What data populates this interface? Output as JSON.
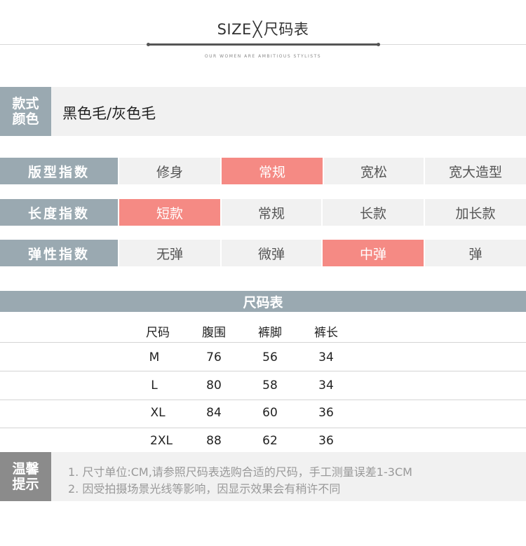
{
  "header": {
    "title_prefix": "SIZE",
    "title_cross": "╳",
    "title_suffix": "尺码表",
    "subtitle": "OUR WOMEN ARE AMBITIOUS STYLISTS"
  },
  "style_row": {
    "label_line1": "款式",
    "label_line2": "颜色",
    "value": "黑色毛/灰色毛"
  },
  "indexes": [
    {
      "label": "版型指数",
      "options": [
        "修身",
        "常规",
        "宽松",
        "宽大造型"
      ],
      "selected": 1
    },
    {
      "label": "长度指数",
      "options": [
        "短款",
        "常规",
        "长款",
        "加长款"
      ],
      "selected": 0
    },
    {
      "label": "弹性指数",
      "options": [
        "无弹",
        "微弹",
        "中弹",
        "弹"
      ],
      "selected": 2
    }
  ],
  "size_table": {
    "title": "尺码表",
    "headers": [
      "尺码",
      "腹围",
      "裤脚",
      "裤长"
    ],
    "rows": [
      [
        "M",
        "76",
        "56",
        "34"
      ],
      [
        "L",
        "80",
        "58",
        "34"
      ],
      [
        "XL",
        "84",
        "60",
        "36"
      ],
      [
        "2XL",
        "88",
        "62",
        "36"
      ]
    ]
  },
  "tips": {
    "label_line1": "温馨",
    "label_line2": "提示",
    "lines": [
      "1. 尺寸单位:CM,请参照尺码表选购合适的尺码，手工测量误差1-3CM",
      "2. 因受拍摄场景光线等影响，因显示效果会有稍许不同"
    ]
  },
  "colors": {
    "label_bg": "#9aa9b1",
    "active_bg": "#f58a84",
    "option_bg": "#f1f1f1",
    "tips_label_bg": "#8b8b8b"
  }
}
